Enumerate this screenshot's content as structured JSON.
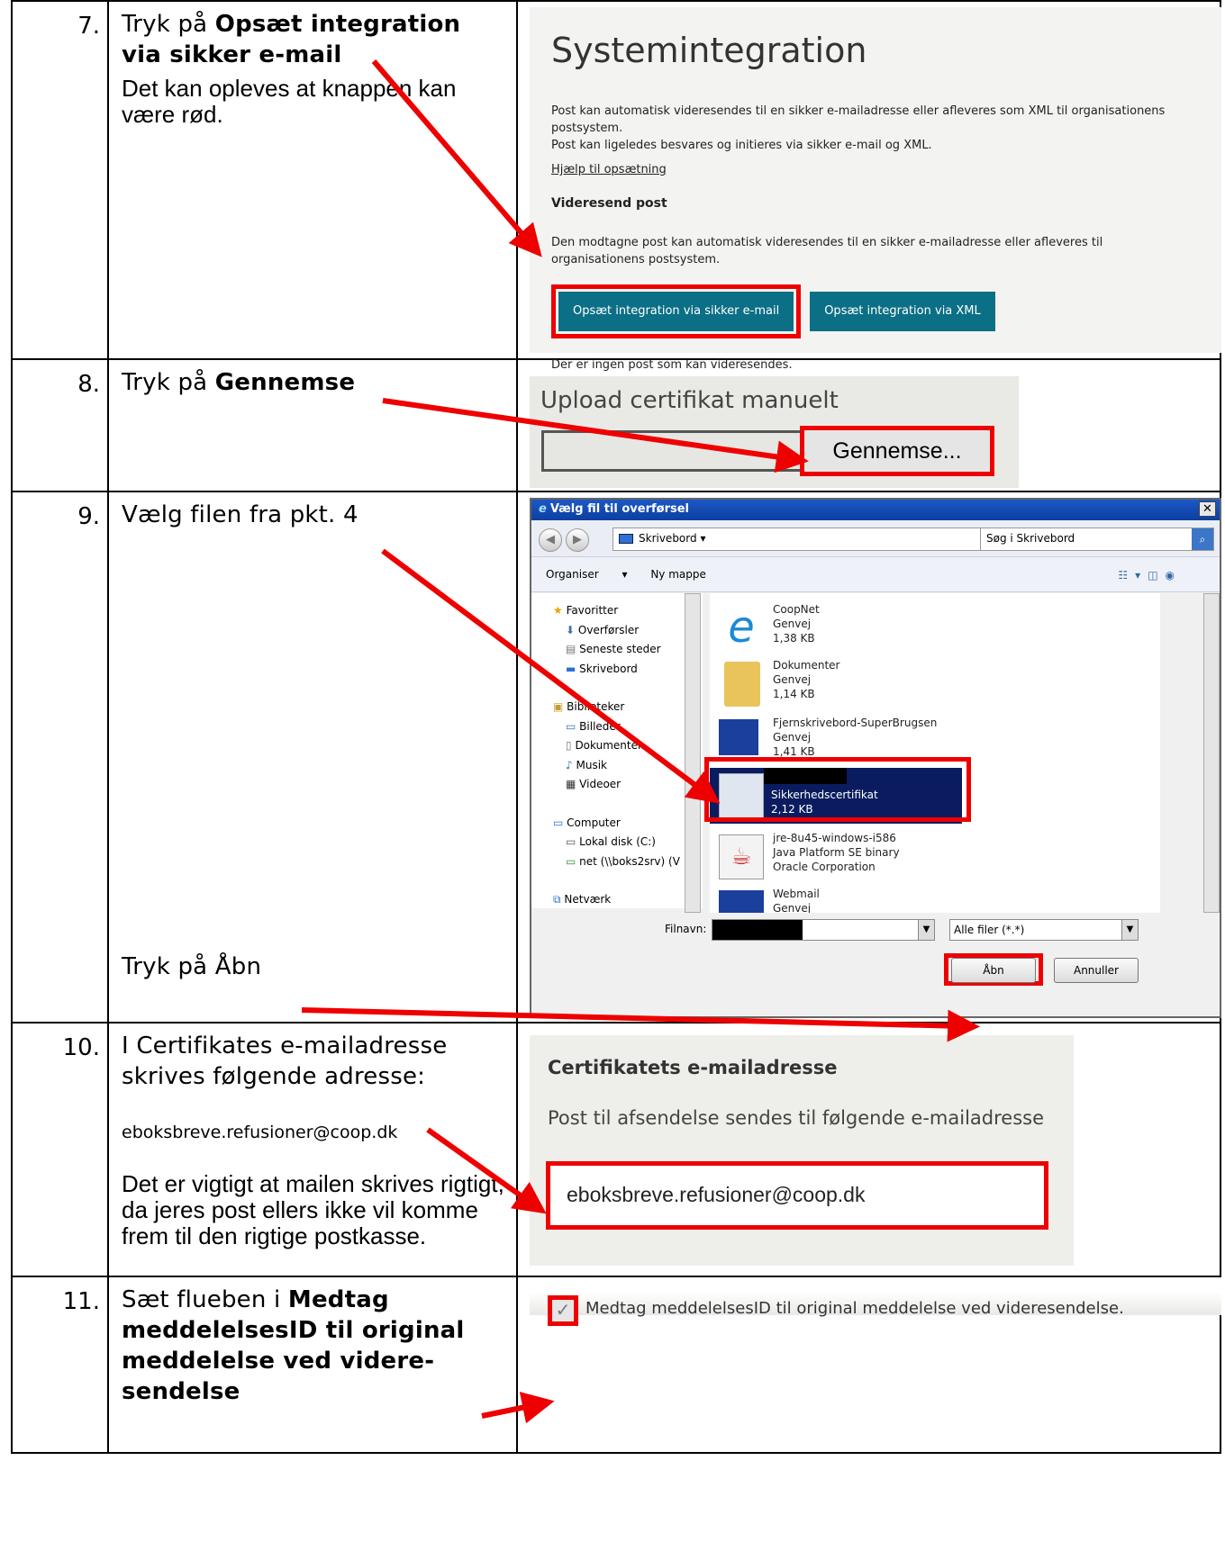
{
  "rows": [
    {
      "num": "7.",
      "pre": "Tryk på ",
      "bold": "Opsæt integration via sikker e-mail",
      "sub": "Det kan opleves at knappen kan være rød."
    },
    {
      "num": "8.",
      "pre": "Tryk på ",
      "bold": "Gennemse"
    },
    {
      "num": "9.",
      "text1": "Vælg filen fra pkt. 4",
      "text2": "Tryk på Åbn"
    },
    {
      "num": "10.",
      "text": "I Certifikates e-mailadresse skrives følgende adresse:",
      "email": "eboksbreve.refusioner@coop.dk",
      "sub": "Det er vigtigt at mailen skrives rigtigt, da jeres post ellers ikke vil komme frem til den rigtige postkasse."
    },
    {
      "num": "11.",
      "pre": "Sæt flueben i ",
      "bold": "Medtag meddelelsesID til original meddelelse ved videre-sendelse"
    }
  ],
  "sys": {
    "title": "Systemintegration",
    "p1": "Post kan automatisk videresendes til en sikker e-mailadresse eller afleveres som XML til organisationens postsystem.",
    "p2": "Post kan ligeledes besvares og initieres via sikker e-mail og XML.",
    "help": "Hjælp til opsætning",
    "heading": "Videresend post",
    "p3": "Den modtagne post kan automatisk videresendes til en sikker e-mailadresse eller afleveres til organisationens postsystem.",
    "btn_email": "Opsæt integration via sikker e-mail",
    "btn_xml": "Opsæt integration via XML",
    "footer": "Der er ingen post som kan videresendes."
  },
  "upload": {
    "title": "Upload certifikat manuelt",
    "browse": "Gennemse..."
  },
  "dialog": {
    "title": "Vælg fil til overførsel",
    "location": "Skrivebord",
    "search_placeholder": "Søg i Skrivebord",
    "organize": "Organiser",
    "new_folder": "Ny mappe",
    "nav": {
      "favorites": "Favoritter",
      "downloads": "Overførsler",
      "recent": "Seneste steder",
      "desktop": "Skrivebord",
      "libraries": "Biblioteker",
      "pictures": "Billeder",
      "documents": "Dokumenter",
      "music": "Musik",
      "videos": "Videoer",
      "computer": "Computer",
      "local_disk": "Lokal disk (C:)",
      "net": "net (\\\\boks2srv) (V",
      "network": "Netværk"
    },
    "files": [
      {
        "name": "CoopNet",
        "type": "Genvej",
        "size": "1,38 KB"
      },
      {
        "name": "Dokumenter",
        "type": "Genvej",
        "size": "1,14 KB"
      },
      {
        "name": "Fjernskrivebord-SuperBrugsen",
        "type": "Genvej",
        "size": "1,41 KB"
      },
      {
        "name": "Sikkerhedscertifikat",
        "type": "",
        "size": "2,12 KB"
      },
      {
        "name": "jre-8u45-windows-i586",
        "type": "Java Platform SE binary",
        "size": "Oracle Corporation"
      },
      {
        "name": "Webmail",
        "type": "Genvej",
        "size": ""
      }
    ],
    "filename_label": "Filnavn:",
    "filter": "Alle filer (*.*)",
    "open": "Åbn",
    "cancel": "Annuller"
  },
  "cert": {
    "heading": "Certifikatets e-mailadresse",
    "desc": "Post til afsendelse sendes til følgende e-mailadresse",
    "email": "eboksbreve.refusioner@coop.dk"
  },
  "medtag": {
    "label": "Medtag meddelelsesID til original meddelelse ved videresendelse."
  },
  "colors": {
    "accent_red": "#e00000",
    "teal_button": "#0b6f85"
  }
}
